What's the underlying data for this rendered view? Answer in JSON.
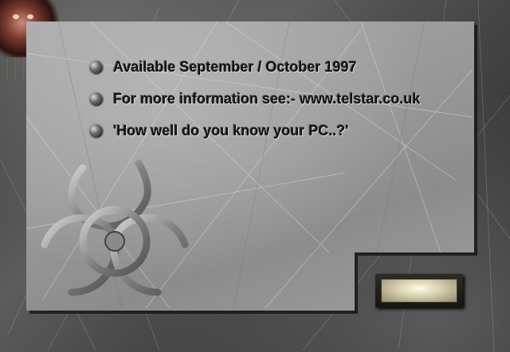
{
  "info": {
    "items": [
      {
        "text": "Available September / October 1997",
        "icon": "sphere-bullet-icon"
      },
      {
        "text": "For more information see:- www.telstar.co.uk",
        "icon": "sphere-bullet-icon"
      },
      {
        "text": "'How well do you know your PC..?'",
        "icon": "sphere-bullet-icon"
      }
    ]
  },
  "decor": {
    "emblem": "biohazard-icon",
    "button": "metal-plate-button"
  },
  "colors": {
    "panel": "#9c9c9c",
    "text": "#111111",
    "button_glow": "#f2ecd0"
  }
}
